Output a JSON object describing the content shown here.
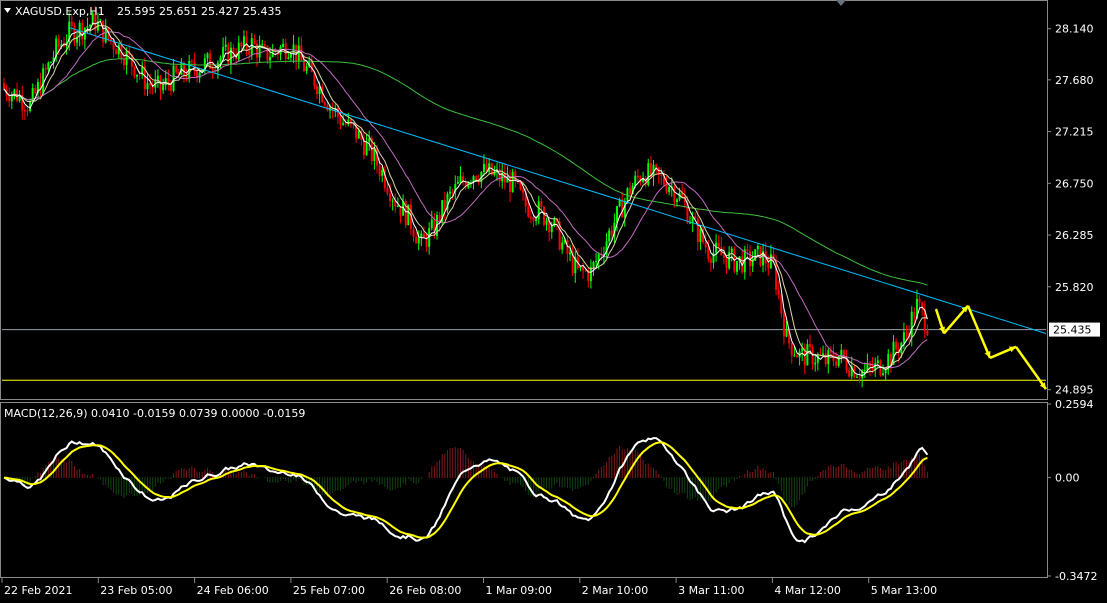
{
  "chart_data": [
    {
      "type": "candlestick",
      "title": "XAGUSD.Exp,H1",
      "ohlc_header": "25.595 25.651 25.427 25.435",
      "price_axis_ticks": [
        "28.140",
        "27.680",
        "27.215",
        "26.750",
        "26.285",
        "25.820",
        "25.435",
        "24.895"
      ],
      "current_price": "25.435",
      "ylim": [
        24.82,
        28.38
      ],
      "bull_color": "#00ff00",
      "bear_color": "#ff0000",
      "time_labels": [
        "22 Feb 2021",
        "23 Feb 05:00",
        "24 Feb 06:00",
        "25 Feb 07:00",
        "26 Feb 08:00",
        "1 Mar 09:00",
        "2 Mar 10:00",
        "3 Mar 11:00",
        "4 Mar 12:00",
        "5 Mar 13:00"
      ],
      "closes": [
        27.6,
        27.55,
        27.45,
        27.7,
        27.95,
        28.1,
        28.15,
        28.2,
        28.05,
        27.95,
        27.8,
        27.65,
        27.6,
        27.7,
        27.75,
        27.8,
        27.85,
        27.9,
        27.95,
        28.0,
        27.9,
        27.95,
        28.0,
        27.8,
        27.65,
        27.45,
        27.3,
        27.2,
        27.05,
        26.85,
        26.6,
        26.45,
        26.2,
        26.35,
        26.6,
        26.75,
        26.85,
        26.85,
        26.8,
        26.75,
        26.55,
        26.5,
        26.4,
        26.15,
        25.95,
        25.95,
        26.2,
        26.45,
        26.7,
        26.85,
        26.8,
        26.75,
        26.6,
        26.35,
        26.15,
        26.1,
        26.05,
        26.05,
        26.1,
        26.0,
        25.35,
        25.2,
        25.2,
        25.15,
        25.2,
        25.1,
        25.05,
        25.1,
        25.2,
        25.35,
        25.65,
        25.45
      ],
      "trendline": {
        "from_price": 28.15,
        "to_price": 25.4,
        "color": "#00bfff"
      },
      "horizontal_lines": [
        {
          "price": 25.435,
          "color": "#9aa0a8"
        },
        {
          "price": 24.98,
          "color": "#ffff00"
        }
      ],
      "projection_color": "#ffff00"
    },
    {
      "type": "macd",
      "title": "MACD(12,26,9) 0.0410 -0.0159 0.0739 0.0000 -0.0159",
      "axis_ticks": [
        "0.2594",
        "0.00",
        "-0.3472"
      ],
      "ylim": [
        -0.3472,
        0.2594
      ],
      "macd_color": "#ffffff",
      "signal_color": "#ffff00",
      "hist_up_color": "#ff3030",
      "hist_down_color": "#1f8a1f"
    }
  ]
}
